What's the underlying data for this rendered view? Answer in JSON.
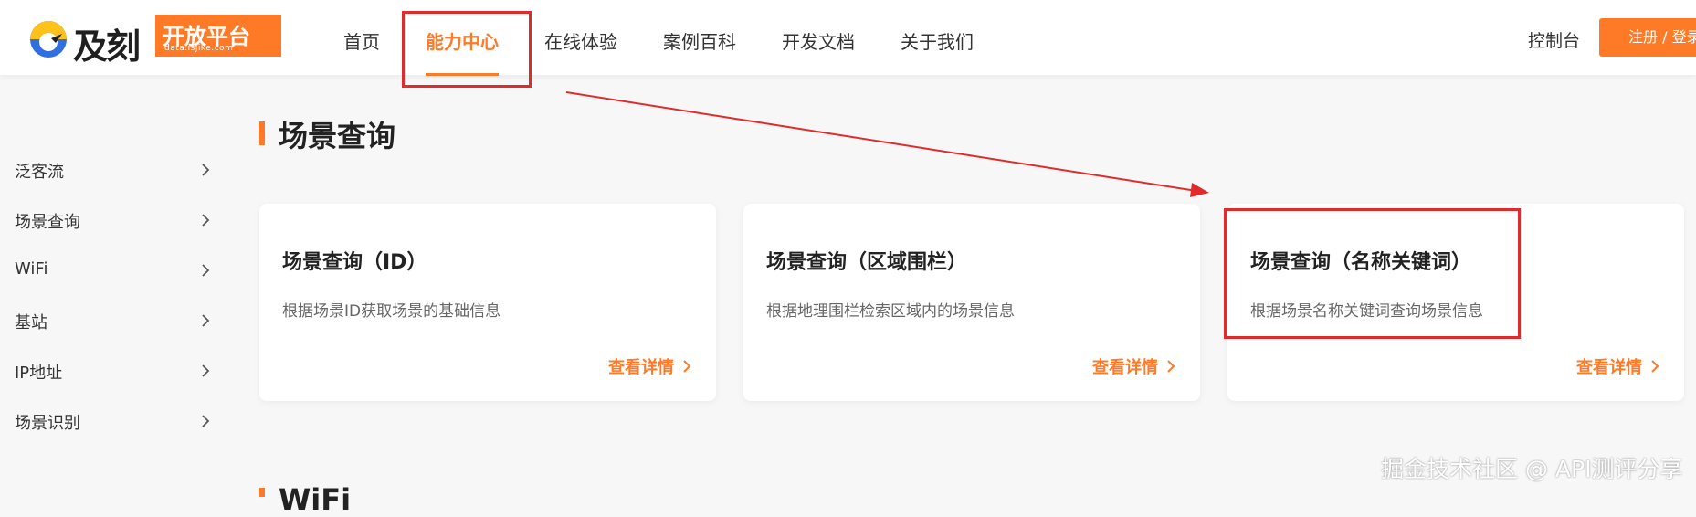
{
  "header": {
    "logo_text": "及刻",
    "logo_tag": "开放平台",
    "logo_domain": "data.isjike.com",
    "nav": [
      {
        "label": "首页"
      },
      {
        "label": "能力中心"
      },
      {
        "label": "在线体验"
      },
      {
        "label": "案例百科"
      },
      {
        "label": "开发文档"
      },
      {
        "label": "关于我们"
      }
    ],
    "active_nav": "能力中心",
    "console": "控制台",
    "login": "注册 / 登录"
  },
  "sidebar": {
    "items": [
      {
        "label": "泛客流"
      },
      {
        "label": "场景查询"
      },
      {
        "label": "WiFi"
      },
      {
        "label": "基站"
      },
      {
        "label": "IP地址"
      },
      {
        "label": "场景识别"
      }
    ]
  },
  "section": {
    "title": "场景查询",
    "next_title": "WiFi"
  },
  "cards": [
    {
      "title": "场景查询（ID）",
      "desc": "根据场景ID获取场景的基础信息",
      "link": "查看详情"
    },
    {
      "title": "场景查询（区域围栏）",
      "desc": "根据地理围栏检索区域内的场景信息",
      "link": "查看详情"
    },
    {
      "title": "场景查询（名称关键词）",
      "desc": "根据场景名称关键词查询场景信息",
      "link": "查看详情"
    }
  ],
  "watermark": "掘金技术社区 @ API测评分享",
  "colors": {
    "accent": "#ff7a26",
    "annotation": "#e12b2b"
  }
}
